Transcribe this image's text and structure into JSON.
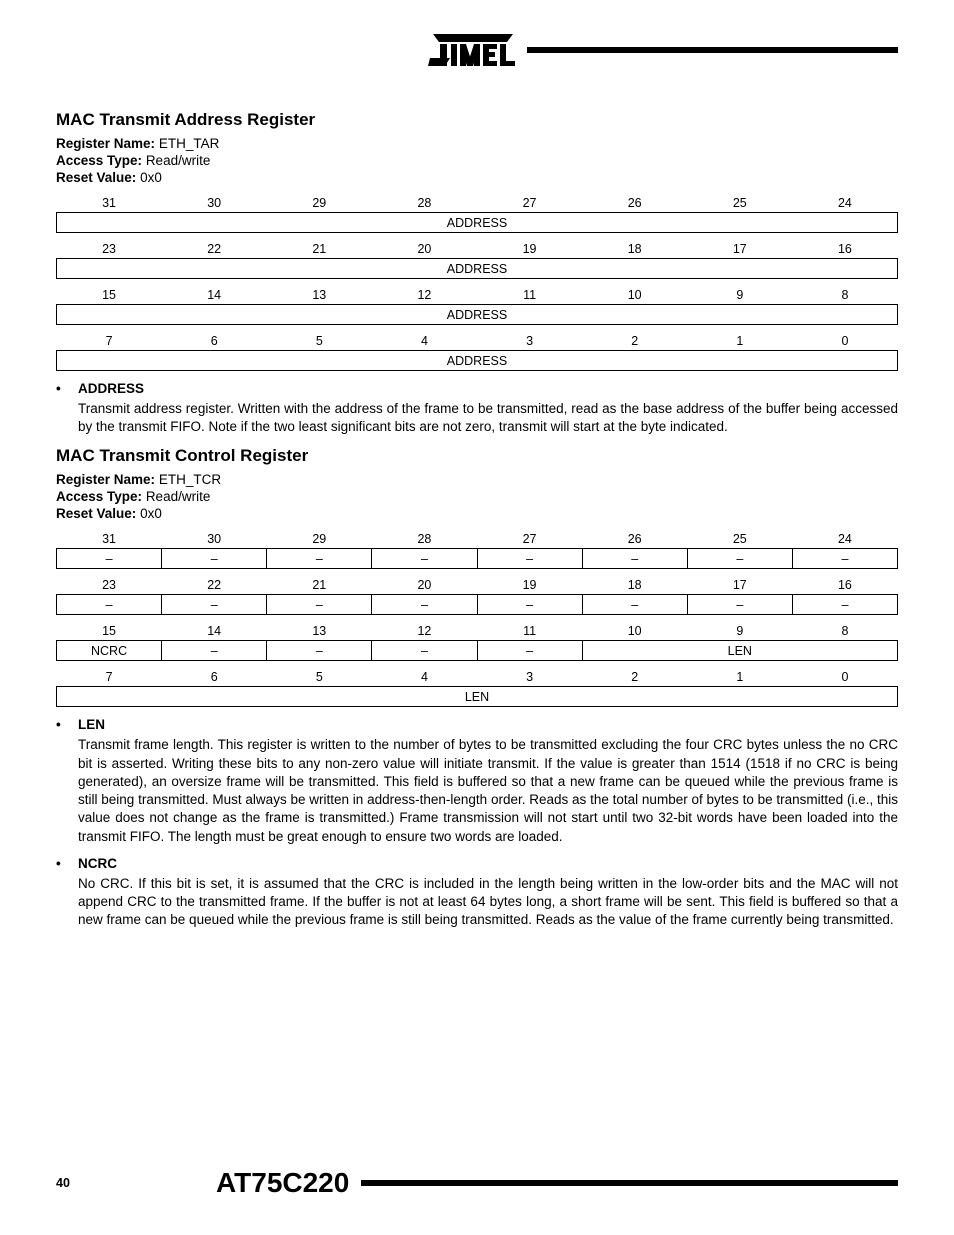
{
  "logo_text": "ATMEL",
  "reg1": {
    "title": "MAC Transmit Address Register",
    "name_label": "Register Name:",
    "name_value": "ETH_TAR",
    "access_label": "Access Type:",
    "access_value": "Read/write",
    "reset_label": "Reset Value:",
    "reset_value": "0x0",
    "rows": [
      {
        "bits": [
          "31",
          "30",
          "29",
          "28",
          "27",
          "26",
          "25",
          "24"
        ],
        "field": "ADDRESS"
      },
      {
        "bits": [
          "23",
          "22",
          "21",
          "20",
          "19",
          "18",
          "17",
          "16"
        ],
        "field": "ADDRESS"
      },
      {
        "bits": [
          "15",
          "14",
          "13",
          "12",
          "11",
          "10",
          "9",
          "8"
        ],
        "field": "ADDRESS"
      },
      {
        "bits": [
          "7",
          "6",
          "5",
          "4",
          "3",
          "2",
          "1",
          "0"
        ],
        "field": "ADDRESS"
      }
    ],
    "bullets": [
      {
        "label": "ADDRESS",
        "desc": "Transmit address register. Written with the address of the frame to be transmitted, read as the base address of the buffer being accessed by the transmit FIFO. Note if the two least significant bits are not zero, transmit will start at the byte indicated."
      }
    ]
  },
  "reg2": {
    "title": "MAC Transmit Control Register",
    "name_label": "Register Name:",
    "name_value": "ETH_TCR",
    "access_label": "Access Type:",
    "access_value": "Read/write",
    "reset_label": "Reset Value:",
    "reset_value": "0x0",
    "rows": [
      {
        "bits": [
          "31",
          "30",
          "29",
          "28",
          "27",
          "26",
          "25",
          "24"
        ],
        "fields": [
          "–",
          "–",
          "–",
          "–",
          "–",
          "–",
          "–",
          "–"
        ]
      },
      {
        "bits": [
          "23",
          "22",
          "21",
          "20",
          "19",
          "18",
          "17",
          "16"
        ],
        "fields": [
          "–",
          "–",
          "–",
          "–",
          "–",
          "–",
          "–",
          "–"
        ]
      },
      {
        "bits": [
          "15",
          "14",
          "13",
          "12",
          "11",
          "10",
          "9",
          "8"
        ],
        "fields_spec": [
          [
            "NCRC",
            1
          ],
          [
            "–",
            1
          ],
          [
            "–",
            1
          ],
          [
            "–",
            1
          ],
          [
            "–",
            1
          ],
          [
            "LEN",
            3
          ]
        ]
      },
      {
        "bits": [
          "7",
          "6",
          "5",
          "4",
          "3",
          "2",
          "1",
          "0"
        ],
        "field": "LEN"
      }
    ],
    "bullets": [
      {
        "label": "LEN",
        "desc": "Transmit frame length. This register is written to the number of bytes to be transmitted excluding the four CRC bytes unless the no CRC bit is asserted. Writing these bits to any non-zero value will initiate transmit. If the value is greater than 1514 (1518 if no CRC is being generated), an oversize frame will be transmitted. This field is buffered so that a new frame can be queued while the previous frame is still being transmitted. Must always be written in address-then-length order. Reads as the total number of bytes to be transmitted (i.e., this value does not change as the frame is transmitted.) Frame transmission will not start until two 32-bit words have been loaded into the transmit FIFO. The length must be great enough to ensure two words are loaded."
      },
      {
        "label": "NCRC",
        "desc": "No CRC. If this bit is set, it is assumed that the CRC is included in the length being written in the low-order bits and the MAC will not append CRC to the transmitted frame. If the buffer is not at least 64 bytes long, a short frame will be sent. This field is buffered so that a new frame can be queued while the previous frame is still being transmitted. Reads as the value of the frame currently being transmitted."
      }
    ]
  },
  "footer": {
    "page": "40",
    "part": "AT75C220"
  }
}
